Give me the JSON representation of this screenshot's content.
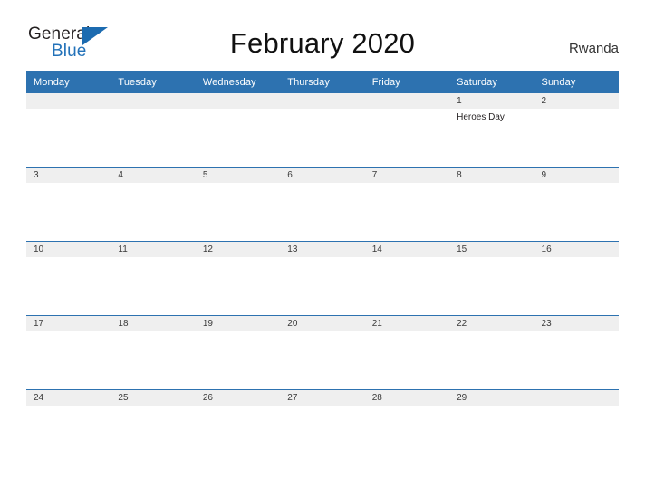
{
  "branding": {
    "logo_primary": "General",
    "logo_secondary": "Blue",
    "logo_triangle_icon": "triangle-icon",
    "accent_blue": "#2d72b0",
    "logo_blue": "#2372b9",
    "band_gray": "#efefef"
  },
  "header": {
    "title": "February 2020",
    "country": "Rwanda"
  },
  "calendar": {
    "weekday_headers": [
      "Monday",
      "Tuesday",
      "Wednesday",
      "Thursday",
      "Friday",
      "Saturday",
      "Sunday"
    ],
    "weeks": [
      [
        {
          "date": "",
          "event": ""
        },
        {
          "date": "",
          "event": ""
        },
        {
          "date": "",
          "event": ""
        },
        {
          "date": "",
          "event": ""
        },
        {
          "date": "",
          "event": ""
        },
        {
          "date": "1",
          "event": "Heroes Day"
        },
        {
          "date": "2",
          "event": ""
        }
      ],
      [
        {
          "date": "3",
          "event": ""
        },
        {
          "date": "4",
          "event": ""
        },
        {
          "date": "5",
          "event": ""
        },
        {
          "date": "6",
          "event": ""
        },
        {
          "date": "7",
          "event": ""
        },
        {
          "date": "8",
          "event": ""
        },
        {
          "date": "9",
          "event": ""
        }
      ],
      [
        {
          "date": "10",
          "event": ""
        },
        {
          "date": "11",
          "event": ""
        },
        {
          "date": "12",
          "event": ""
        },
        {
          "date": "13",
          "event": ""
        },
        {
          "date": "14",
          "event": ""
        },
        {
          "date": "15",
          "event": ""
        },
        {
          "date": "16",
          "event": ""
        }
      ],
      [
        {
          "date": "17",
          "event": ""
        },
        {
          "date": "18",
          "event": ""
        },
        {
          "date": "19",
          "event": ""
        },
        {
          "date": "20",
          "event": ""
        },
        {
          "date": "21",
          "event": ""
        },
        {
          "date": "22",
          "event": ""
        },
        {
          "date": "23",
          "event": ""
        }
      ],
      [
        {
          "date": "24",
          "event": ""
        },
        {
          "date": "25",
          "event": ""
        },
        {
          "date": "26",
          "event": ""
        },
        {
          "date": "27",
          "event": ""
        },
        {
          "date": "28",
          "event": ""
        },
        {
          "date": "29",
          "event": ""
        },
        {
          "date": "",
          "event": ""
        }
      ]
    ]
  }
}
